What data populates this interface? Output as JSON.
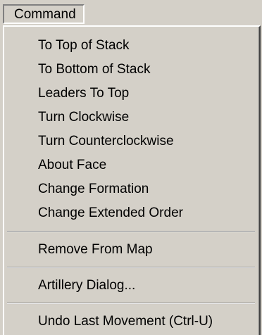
{
  "menubar": {
    "command_label": "Command"
  },
  "menu": {
    "items": [
      "To Top of Stack",
      "To Bottom of Stack",
      "Leaders To Top",
      "Turn Clockwise",
      "Turn Counterclockwise",
      "About Face",
      "Change Formation",
      "Change Extended Order",
      "Remove From Map",
      "Artillery Dialog...",
      "Undo Last Movement (Ctrl-U)"
    ]
  }
}
